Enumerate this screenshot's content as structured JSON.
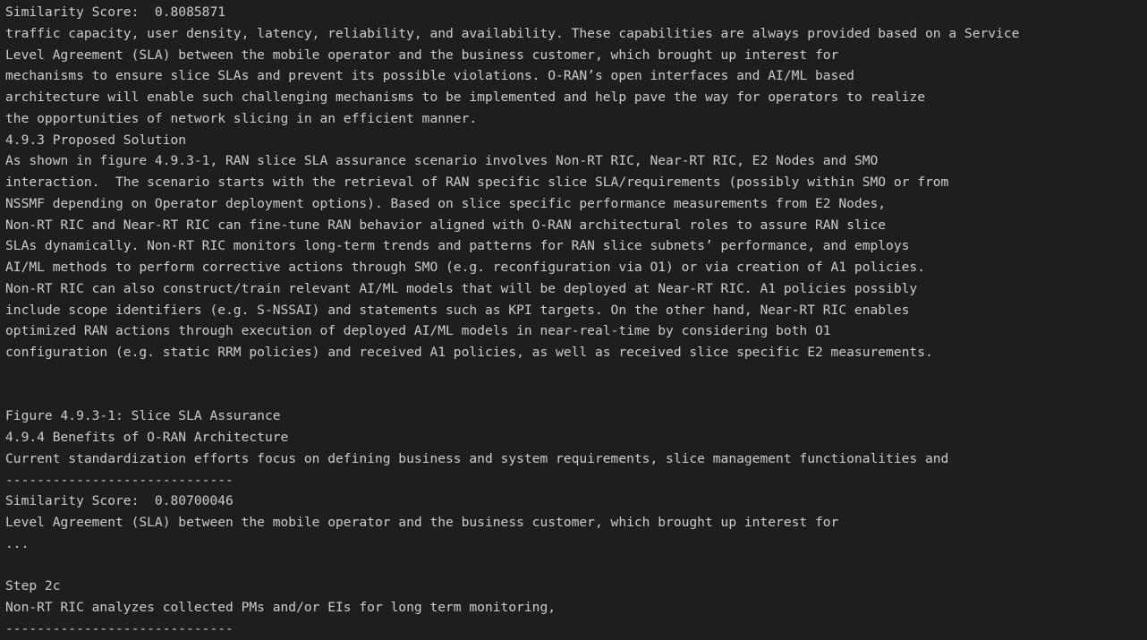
{
  "terminal": {
    "lines": [
      "Similarity Score:  0.8085871",
      "traffic capacity, user density, latency, reliability, and availability. These capabilities are always provided based on a Service",
      "Level Agreement (SLA) between the mobile operator and the business customer, which brought up interest for",
      "mechanisms to ensure slice SLAs and prevent its possible violations. O-RAN’s open interfaces and AI/ML based",
      "architecture will enable such challenging mechanisms to be implemented and help pave the way for operators to realize",
      "the opportunities of network slicing in an efficient manner.",
      "4.9.3 Proposed Solution",
      "As shown in figure 4.9.3-1, RAN slice SLA assurance scenario involves Non-RT RIC, Near-RT RIC, E2 Nodes and SMO",
      "interaction.  The scenario starts with the retrieval of RAN specific slice SLA/requirements (possibly within SMO or from",
      "NSSMF depending on Operator deployment options). Based on slice specific performance measurements from E2 Nodes,",
      "Non-RT RIC and Near-RT RIC can fine-tune RAN behavior aligned with O-RAN architectural roles to assure RAN slice",
      "SLAs dynamically. Non-RT RIC monitors long-term trends and patterns for RAN slice subnets’ performance, and employs",
      "AI/ML methods to perform corrective actions through SMO (e.g. reconfiguration via O1) or via creation of A1 policies.",
      "Non-RT RIC can also construct/train relevant AI/ML models that will be deployed at Near-RT RIC. A1 policies possibly",
      "include scope identifiers (e.g. S-NSSAI) and statements such as KPI targets. On the other hand, Near-RT RIC enables",
      "optimized RAN actions through execution of deployed AI/ML models in near-real-time by considering both O1",
      "configuration (e.g. static RRM policies) and received A1 policies, as well as received slice specific E2 measurements.",
      "",
      "",
      "Figure 4.9.3-1: Slice SLA Assurance",
      "4.9.4 Benefits of O-RAN Architecture",
      "Current standardization efforts focus on defining business and system requirements, slice management functionalities and",
      "-----------------------------",
      "Similarity Score:  0.80700046",
      "Level Agreement (SLA) between the mobile operator and the business customer, which brought up interest for",
      "...",
      "",
      "Step 2c",
      "Non-RT RIC analyzes collected PMs and/or EIs for long term monitoring,",
      "-----------------------------"
    ]
  }
}
